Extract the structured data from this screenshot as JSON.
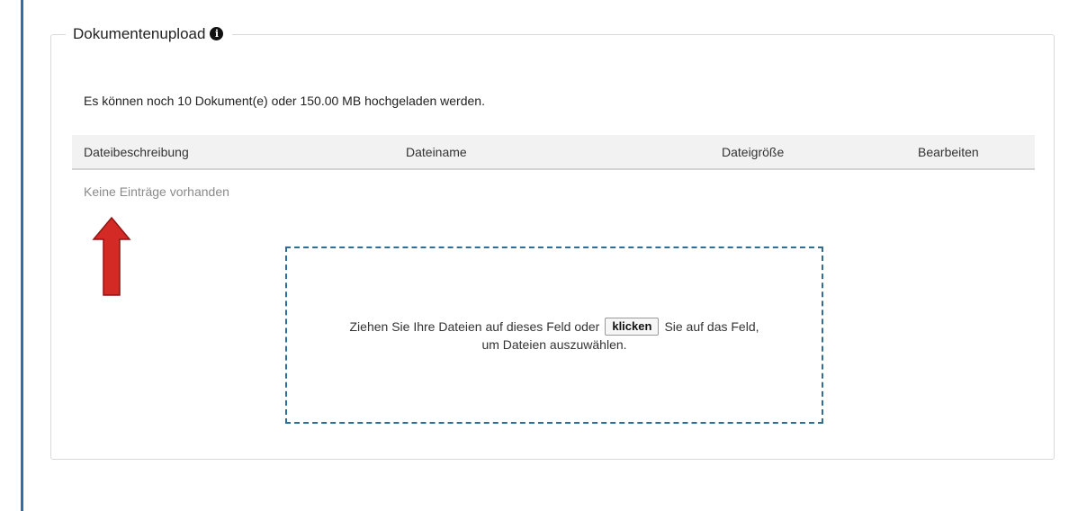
{
  "panel": {
    "legend": "Dokumentenupload",
    "info_icon": "info-circle-icon"
  },
  "quota_text": "Es können noch 10 Dokument(e) oder 150.00 MB hochgeladen werden.",
  "table": {
    "columns": [
      "Dateibeschreibung",
      "Dateiname",
      "Dateigröße",
      "Bearbeiten"
    ],
    "rows": [],
    "empty_text": "Keine Einträge vorhanden"
  },
  "dropzone": {
    "text_before": "Ziehen Sie Ihre Dateien auf dieses Feld oder",
    "button_label": "klicken",
    "text_after": "Sie auf das Feld,",
    "text_line2": "um Dateien auszuwählen."
  },
  "annotation": {
    "arrow_icon": "red-up-arrow-icon",
    "arrow_color": "#d42a26"
  },
  "colors": {
    "accent_rule": "#2f6fa8",
    "dropzone_border": "#2f6d96",
    "header_bg": "#f2f2f2"
  }
}
